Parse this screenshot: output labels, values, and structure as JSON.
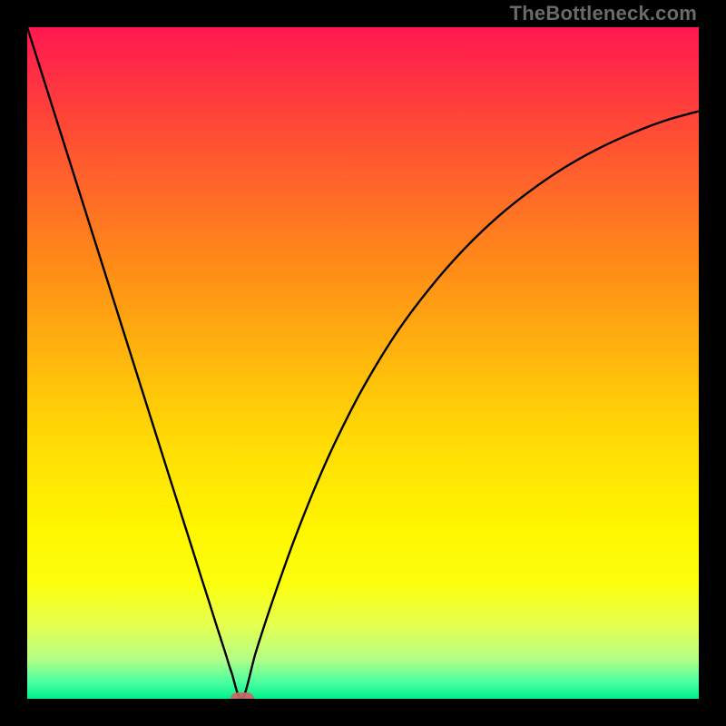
{
  "watermark": "TheBottleneck.com",
  "chart_data": {
    "type": "line",
    "title": "",
    "xlabel": "",
    "ylabel": "",
    "xlim": [
      0,
      100
    ],
    "ylim": [
      0,
      100
    ],
    "background_gradient": {
      "top": "#ff1850",
      "mid": "#ffe000",
      "bottom": "#00f08c"
    },
    "series": [
      {
        "name": "bottleneck-curve",
        "color": "#000000",
        "x": [
          0,
          5,
          10,
          15,
          18,
          21,
          23,
          25,
          26,
          27,
          28,
          29,
          29.7,
          30.4,
          32,
          34,
          36,
          38,
          40,
          43,
          46,
          50,
          55,
          60,
          65,
          70,
          75,
          80,
          85,
          90,
          95,
          100
        ],
        "values": [
          100,
          84.2,
          68.4,
          52.6,
          43.1,
          33.6,
          27.3,
          21.0,
          17.8,
          14.7,
          11.5,
          8.4,
          6.2,
          4.0,
          0,
          6.8,
          13.0,
          18.8,
          24.3,
          31.8,
          38.5,
          46.3,
          54.5,
          61.2,
          66.9,
          71.7,
          75.7,
          79.1,
          81.9,
          84.2,
          86.1,
          87.5
        ]
      }
    ],
    "annotations": [
      {
        "name": "optimal-marker",
        "shape": "pill",
        "color": "#cc6666",
        "x": 32,
        "y": 0
      }
    ]
  }
}
